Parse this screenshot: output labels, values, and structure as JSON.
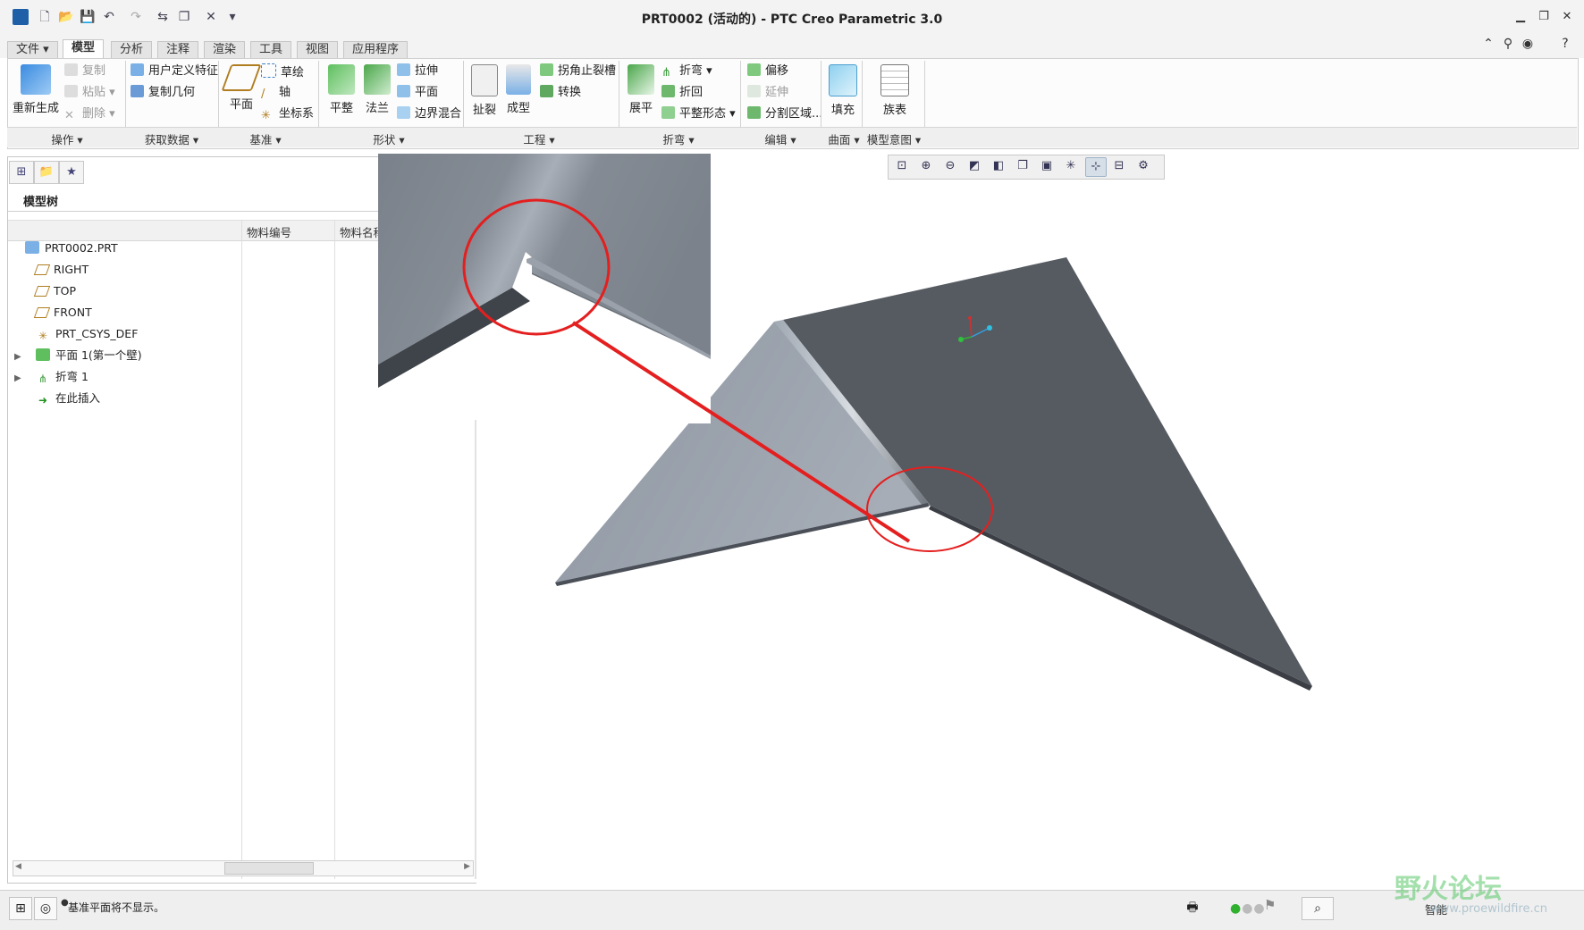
{
  "window": {
    "title": "PRT0002 (活动的) - PTC Creo Parametric 3.0",
    "controls": [
      "minimize",
      "restore",
      "close"
    ]
  },
  "quick_access": [
    "new-icon",
    "open-icon",
    "save-icon",
    "undo-icon",
    "redo-icon",
    "regenerate-icon",
    "windows-icon",
    "close-window-icon",
    "customize-icon"
  ],
  "tabs": [
    {
      "label": "文件 ▾",
      "active": false
    },
    {
      "label": "模型",
      "active": true
    },
    {
      "label": "分析",
      "active": false
    },
    {
      "label": "注释",
      "active": false
    },
    {
      "label": "渲染",
      "active": false
    },
    {
      "label": "工具",
      "active": false
    },
    {
      "label": "视图",
      "active": false
    },
    {
      "label": "应用程序",
      "active": false
    }
  ],
  "ribbon": {
    "operations": {
      "regenerate": "重新生成",
      "copy": "复制",
      "paste": "粘贴",
      "delete": "删除",
      "group": "操作"
    },
    "get_data": {
      "udf": "用户定义特征",
      "copy_geom": "复制几何",
      "group": "获取数据"
    },
    "datum": {
      "plane": "平面",
      "sketch": "草绘",
      "axis": "轴",
      "csys": "坐标系",
      "group": "基准"
    },
    "shapes": {
      "planar": "平整",
      "flange": "法兰",
      "extrude": "拉伸",
      "plane": "平面",
      "blend": "边界混合",
      "group": "形状"
    },
    "engineering": {
      "rip": "扯裂",
      "form": "成型",
      "corner_relief": "拐角止裂槽",
      "convert": "转换",
      "group": "工程"
    },
    "bends": {
      "unbend": "展平",
      "bend": "折弯",
      "bend_back": "折回",
      "flat_state": "平整形态",
      "group": "折弯"
    },
    "editing": {
      "offset": "偏移",
      "extend": "延伸",
      "split": "分割区域...",
      "group": "编辑"
    },
    "surfaces": {
      "fill": "填充",
      "group": "曲面"
    },
    "intent": {
      "family": "族表",
      "group": "模型意图"
    }
  },
  "model_tree": {
    "title": "模型树",
    "columns": [
      "物料编号",
      "物料名称"
    ],
    "items": [
      {
        "label": "PRT0002.PRT",
        "icon": "part-icon",
        "expandable": false
      },
      {
        "label": "RIGHT",
        "icon": "datum-plane-icon",
        "expandable": false
      },
      {
        "label": "TOP",
        "icon": "datum-plane-icon",
        "expandable": false
      },
      {
        "label": "FRONT",
        "icon": "datum-plane-icon",
        "expandable": false
      },
      {
        "label": "PRT_CSYS_DEF",
        "icon": "csys-icon",
        "expandable": false
      },
      {
        "label": "平面 1(第一个壁)",
        "icon": "planar-wall-icon",
        "expandable": true
      },
      {
        "label": "折弯 1",
        "icon": "bend-icon",
        "expandable": true
      },
      {
        "label": "在此插入",
        "icon": "insert-here-icon",
        "expandable": false
      }
    ]
  },
  "view_toolbar": [
    "refit-icon",
    "zoom-in-icon",
    "zoom-out-icon",
    "repaint-icon",
    "display-style-icon",
    "saved-views-icon",
    "view-manager-icon",
    "datum-display-icon",
    "spin-center-icon",
    "annotation-display-icon",
    "appearance-icon"
  ],
  "status": {
    "message": "基准平面将不显示。",
    "filter": "智能"
  },
  "watermark": {
    "text": "野火论坛",
    "url": "www.proewildfire.cn"
  },
  "colors": {
    "accent": "#1e73be",
    "callout": "#e41f1f",
    "sheet_light": "#9aa2ad",
    "sheet_dark": "#565b62"
  }
}
